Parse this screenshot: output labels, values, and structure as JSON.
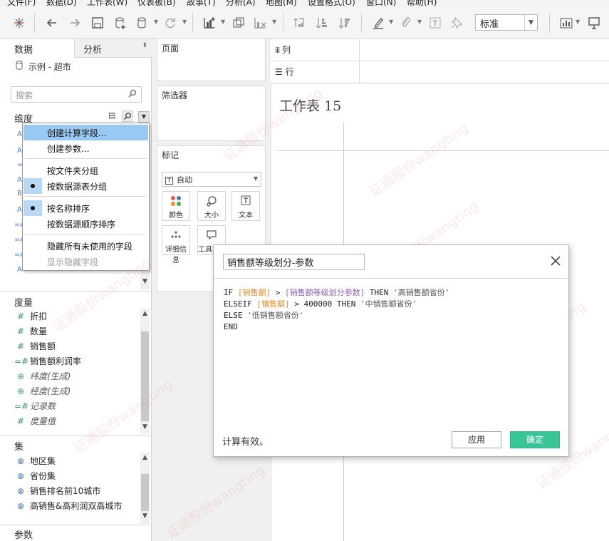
{
  "menubar": {
    "items": [
      "文件(F)",
      "数据(D)",
      "工作表(W)",
      "仪表板(B)",
      "故事(T)",
      "分析(A)",
      "地图(M)",
      "设置格式(O)",
      "窗口(N)",
      "帮助(H)"
    ]
  },
  "toolbar": {
    "icons": [
      "tableau-logo-icon",
      "undo-icon",
      "redo-icon",
      "save-icon",
      "new-datasource-icon",
      "datasource-icon",
      "refresh-icon",
      "new-worksheet-icon",
      "duplicate-icon",
      "clear-icon",
      "swap-icon",
      "sort-asc-icon",
      "sort-desc-icon",
      "highlight-icon",
      "group-icon",
      "labels-icon",
      "pin-icon",
      "show-me-icon",
      "presentation-icon"
    ],
    "fit_value": "标准"
  },
  "left_panel": {
    "tabs": [
      "数据",
      "分析"
    ],
    "datasource": "示例 - 超市",
    "search_placeholder": "搜索",
    "dimensions_title": "维度",
    "measures_title": "度量",
    "measures": [
      {
        "icon": "#",
        "label": "折扣",
        "italic": false
      },
      {
        "icon": "#",
        "label": "数量",
        "italic": false
      },
      {
        "icon": "#",
        "label": "销售额",
        "italic": false
      },
      {
        "icon": "=#",
        "label": "销售额利润率",
        "italic": false
      },
      {
        "icon": "globe",
        "label": "纬度(生成)",
        "italic": true
      },
      {
        "icon": "globe",
        "label": "经度(生成)",
        "italic": true
      },
      {
        "icon": "=#",
        "label": "记录数",
        "italic": true
      },
      {
        "icon": "#",
        "label": "度量值",
        "italic": true
      }
    ],
    "sets_title": "集",
    "sets": [
      "地区集",
      "省份集",
      "销售排名前10城市",
      "高销售&高利润双高城市"
    ],
    "params_title": "参数"
  },
  "context_menu": {
    "items": [
      {
        "label": "创建计算字段...",
        "state": "selected"
      },
      {
        "label": "创建参数...",
        "state": "normal"
      },
      {
        "label": "按文件夹分组",
        "state": "normal"
      },
      {
        "label": "按数据源表分组",
        "state": "checked"
      },
      {
        "label": "按名称排序",
        "state": "checked"
      },
      {
        "label": "按数据源顺序排序",
        "state": "normal"
      },
      {
        "label": "隐藏所有未使用的字段",
        "state": "normal"
      },
      {
        "label": "显示隐藏字段",
        "state": "disabled"
      }
    ]
  },
  "middle_panel": {
    "pages_title": "页面",
    "filters_title": "筛选器",
    "marks_title": "标记",
    "marks_type": "自动",
    "mark_buttons": [
      "颜色",
      "大小",
      "文本",
      "详细信息",
      "工具提示"
    ]
  },
  "shelves": {
    "columns": "列",
    "rows": "行"
  },
  "canvas": {
    "sheet_title": "工作表 15"
  },
  "calc_dialog": {
    "name": "销售额等级划分-参数",
    "code": {
      "l1_kw": "IF ",
      "l1_f": "[销售额]",
      "l1_op": " > ",
      "l1_p": "[销售额等级划分参数]",
      "l1_then": " THEN ",
      "l1_s": "'高销售额省份'",
      "l2_kw": "ELSEIF ",
      "l2_f": "[销售额]",
      "l2_op": " > ",
      "l2_n": "400000",
      "l2_then": " THEN ",
      "l2_s": "'中销售额省份'",
      "l3_kw": "ELSE ",
      "l3_s": "'低销售额省份'",
      "l4_kw": "END"
    },
    "status": "计算有效。",
    "apply_label": "应用",
    "ok_label": "确定"
  },
  "watermark": "证通股份wangting",
  "colors": {
    "ok_button": "#3ac599",
    "field_ref": "#e08b2c",
    "param_ref": "#8c62b6",
    "menu_highlight": "#99c9f2"
  }
}
